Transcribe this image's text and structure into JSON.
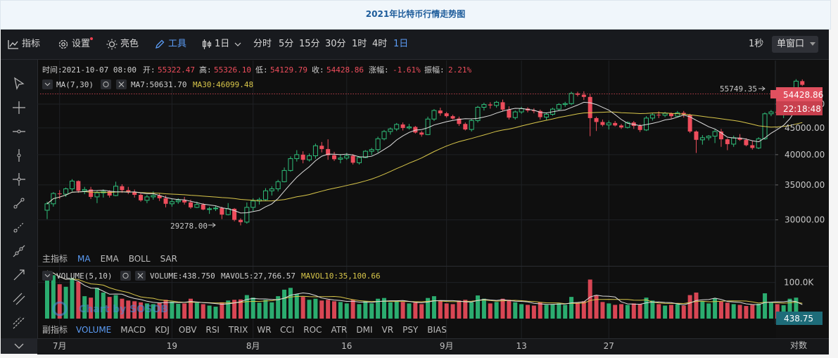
{
  "page": {
    "title": "2021年比特币行情走势图"
  },
  "toolbar": {
    "indicator_label": "指标",
    "settings_label": "设置",
    "theme_label": "亮色",
    "tools_label": "工具",
    "interval_selected": "1日",
    "intervals": [
      "分时",
      "5分",
      "15分",
      "30分",
      "1时",
      "4时",
      "1日"
    ],
    "active_interval": "1日",
    "right_interval": "1秒",
    "layout_label": "单窗口"
  },
  "main_info": {
    "time_label": "时间:",
    "time_value": "2021-10-07 08:00",
    "open_label": "开:",
    "open_value": "55322.47",
    "high_label": "高:",
    "high_value": "55326.10",
    "low_label": "低:",
    "low_value": "54129.79",
    "close_label": "收:",
    "close_value": "54428.86",
    "change_label": "涨幅:",
    "change_value": "-1.61%",
    "amp_label": "振幅:",
    "amp_value": "2.21%"
  },
  "ma_legend": {
    "name": "MA(7,30)",
    "ma7_label": "MA7:50631.70",
    "ma30_label": "MA30:46099.48"
  },
  "main_tabs": {
    "label": "主指标",
    "items": [
      "MA",
      "EMA",
      "BOLL",
      "SAR"
    ],
    "active": "MA"
  },
  "vol_legend": {
    "name": "VOLUME(5,10)",
    "vol_label": "VOLUME:438.750",
    "mavol5_label": "MAVOL5:27,766.57",
    "mavol10_label": "MAVOL10:35,100.66"
  },
  "sub_tabs": {
    "label": "副指标",
    "items": [
      "VOLUME",
      "MACD",
      "KDJ",
      "OBV",
      "RSI",
      "TRIX",
      "WR",
      "CCI",
      "ROC",
      "ATR",
      "DMI",
      "VR",
      "PSY",
      "BIAS"
    ],
    "active": "VOLUME"
  },
  "watermark": "Chart by SOSOB",
  "x_axis": {
    "ticks": [
      "7月",
      "19",
      "8月",
      "16",
      "9月",
      "13",
      "27"
    ],
    "right_label": "对数"
  },
  "price_tags": {
    "last": "54428.86",
    "countdown": "22:18:48",
    "vol_last": "438.75"
  },
  "annotations": {
    "max": "55749.35",
    "min": "29278.00"
  },
  "colors": {
    "up": "#2fbe7a",
    "down": "#ee4d5c",
    "ma7": "#dcdcdc",
    "ma30": "#d8c64a",
    "accent": "#5b9cf5"
  },
  "chart_data": {
    "type": "candlestick",
    "title": "2021年比特币行情走势图",
    "x_start_date": "2021-06-29",
    "x_end_date": "2021-10-07",
    "x_tick_dates": [
      "2021-07-01",
      "2021-07-19",
      "2021-08-01",
      "2021-08-16",
      "2021-09-01",
      "2021-09-13",
      "2021-09-27"
    ],
    "y_ticks": [
      30000,
      35000,
      40000,
      45000,
      50000
    ],
    "y_tick_labels": [
      "30000.00",
      "35000.00",
      "40000.00",
      "45000.00",
      "50000.00"
    ],
    "y_scale": "log",
    "ylim": [
      26300,
      60600
    ],
    "vol_ticks": [
      100000
    ],
    "vol_tick_labels": [
      "100.0K"
    ],
    "vol_max": 140000,
    "ohlc": [
      [
        31300,
        32500,
        30100,
        32200
      ],
      [
        32200,
        33900,
        31800,
        33700
      ],
      [
        33700,
        34200,
        32900,
        33600
      ],
      [
        33600,
        34600,
        33200,
        34400
      ],
      [
        34400,
        35900,
        34000,
        35600
      ],
      [
        35600,
        35700,
        33800,
        34100
      ],
      [
        34100,
        34700,
        33600,
        34300
      ],
      [
        34300,
        34700,
        32900,
        33200
      ],
      [
        33200,
        34100,
        32300,
        33800
      ],
      [
        33800,
        34300,
        33100,
        34000
      ],
      [
        34000,
        34200,
        33100,
        33400
      ],
      [
        33400,
        35500,
        33300,
        34800
      ],
      [
        34800,
        35100,
        33800,
        34200
      ],
      [
        34200,
        34700,
        33600,
        33900
      ],
      [
        33900,
        34300,
        33100,
        33500
      ],
      [
        33500,
        33700,
        32500,
        32700
      ],
      [
        32700,
        33500,
        32300,
        33200
      ],
      [
        33200,
        34000,
        32800,
        33400
      ],
      [
        33400,
        33700,
        32600,
        33000
      ],
      [
        33000,
        33400,
        31700,
        32200
      ],
      [
        32200,
        32900,
        31800,
        32500
      ],
      [
        32500,
        33000,
        32200,
        32700
      ],
      [
        32700,
        33200,
        32100,
        32400
      ],
      [
        32400,
        32800,
        31500,
        31700
      ],
      [
        31700,
        32500,
        31600,
        32100
      ],
      [
        32100,
        32300,
        31300,
        31400
      ],
      [
        31400,
        31800,
        30800,
        31500
      ],
      [
        31500,
        31900,
        31200,
        31600
      ],
      [
        31600,
        31800,
        30100,
        30700
      ],
      [
        30700,
        32300,
        30600,
        31500
      ],
      [
        31500,
        31600,
        29800,
        30000
      ],
      [
        30000,
        30200,
        29278,
        29700
      ],
      [
        29700,
        32400,
        29500,
        31700
      ],
      [
        31700,
        33000,
        31200,
        32600
      ],
      [
        32600,
        33100,
        32100,
        32800
      ],
      [
        32800,
        34500,
        32600,
        34100
      ],
      [
        34100,
        34800,
        33400,
        34400
      ],
      [
        34400,
        35800,
        34000,
        35500
      ],
      [
        35500,
        37800,
        35400,
        37300
      ],
      [
        37300,
        39700,
        37100,
        39300
      ],
      [
        39300,
        40800,
        38800,
        40000
      ],
      [
        40000,
        40600,
        38500,
        39100
      ],
      [
        39100,
        40200,
        38800,
        39800
      ],
      [
        39800,
        42000,
        39300,
        41600
      ],
      [
        41600,
        42300,
        40400,
        41000
      ],
      [
        41000,
        42800,
        39100,
        39900
      ],
      [
        39900,
        40500,
        38900,
        39200
      ],
      [
        39200,
        40100,
        38500,
        39400
      ],
      [
        39400,
        40300,
        39100,
        39800
      ],
      [
        39800,
        40100,
        38300,
        38600
      ],
      [
        38600,
        39700,
        38300,
        39500
      ],
      [
        39500,
        40800,
        39400,
        40600
      ],
      [
        40600,
        41200,
        39900,
        40900
      ],
      [
        40900,
        43300,
        40400,
        42900
      ],
      [
        42900,
        44600,
        42600,
        44300
      ],
      [
        44300,
        45100,
        43700,
        44800
      ],
      [
        44800,
        46000,
        44400,
        45700
      ],
      [
        45700,
        46100,
        44500,
        45000
      ],
      [
        45000,
        45800,
        44700,
        45200
      ],
      [
        45200,
        45400,
        43900,
        44100
      ],
      [
        44100,
        44400,
        43300,
        43700
      ],
      [
        43700,
        47300,
        43600,
        46800
      ],
      [
        46800,
        48900,
        46400,
        48600
      ],
      [
        48600,
        49200,
        47500,
        48000
      ],
      [
        48000,
        48300,
        47100,
        47400
      ],
      [
        47400,
        47700,
        46700,
        46900
      ],
      [
        46900,
        47300,
        45400,
        45800
      ],
      [
        45800,
        46100,
        44500,
        44700
      ],
      [
        44700,
        46900,
        44300,
        46500
      ],
      [
        46500,
        49600,
        46100,
        49300
      ],
      [
        49300,
        50300,
        48600,
        49900
      ],
      [
        49900,
        50400,
        49000,
        49700
      ],
      [
        49700,
        50700,
        49200,
        50400
      ],
      [
        50400,
        51000,
        48500,
        48800
      ],
      [
        48800,
        49500,
        46700,
        47100
      ],
      [
        47100,
        48600,
        46700,
        48300
      ],
      [
        48300,
        49400,
        47900,
        49000
      ],
      [
        49000,
        49300,
        48200,
        48600
      ],
      [
        48600,
        49100,
        48000,
        48500
      ],
      [
        48500,
        48800,
        46700,
        47200
      ],
      [
        47200,
        48200,
        46600,
        47800
      ],
      [
        47800,
        49200,
        47500,
        48900
      ],
      [
        48900,
        50200,
        48600,
        49900
      ],
      [
        49900,
        50500,
        49400,
        50100
      ],
      [
        50100,
        52800,
        49800,
        52400
      ],
      [
        52400,
        52800,
        51700,
        52100
      ],
      [
        52100,
        52900,
        50900,
        51600
      ],
      [
        51600,
        52300,
        43400,
        47000
      ],
      [
        47000,
        47300,
        44400,
        46200
      ],
      [
        46200,
        46700,
        45300,
        45600
      ],
      [
        45600,
        46500,
        44700,
        46000
      ],
      [
        46000,
        46400,
        45300,
        45500
      ],
      [
        45500,
        45800,
        44800,
        45100
      ],
      [
        45100,
        46300,
        44900,
        46100
      ],
      [
        46100,
        46400,
        44800,
        45400
      ],
      [
        45400,
        45800,
        44200,
        44600
      ],
      [
        44600,
        47400,
        44400,
        47000
      ],
      [
        47000,
        48000,
        46500,
        47700
      ],
      [
        47700,
        48400,
        47000,
        47600
      ],
      [
        47600,
        48300,
        47200,
        48000
      ],
      [
        48000,
        48200,
        46900,
        47400
      ],
      [
        47400,
        48500,
        47300,
        48100
      ],
      [
        48100,
        48500,
        47100,
        47700
      ],
      [
        47700,
        47900,
        44000,
        44300
      ],
      [
        44300,
        44500,
        40300,
        42700
      ],
      [
        42700,
        43600,
        41800,
        43100
      ],
      [
        43100,
        43600,
        42600,
        43400
      ],
      [
        43400,
        44700,
        42100,
        44300
      ],
      [
        44300,
        44800,
        41400,
        42800
      ],
      [
        42800,
        43000,
        40800,
        41900
      ],
      [
        41900,
        43500,
        41400,
        43100
      ],
      [
        43100,
        43800,
        42500,
        42700
      ],
      [
        42700,
        43000,
        41500,
        41700
      ],
      [
        41700,
        42500,
        40900,
        41200
      ],
      [
        41200,
        43200,
        41000,
        42900
      ],
      [
        42900,
        48200,
        42700,
        47900
      ],
      [
        47900,
        48700,
        47400,
        48300
      ],
      [
        48300,
        49400,
        47900,
        48200
      ],
      [
        48200,
        48800,
        47000,
        48500
      ],
      [
        48500,
        51600,
        48200,
        51000
      ],
      [
        51000,
        55800,
        50700,
        55322
      ],
      [
        55322,
        55749,
        54130,
        54429
      ]
    ],
    "volume": [
      132000,
      120000,
      95000,
      88000,
      112000,
      102000,
      62000,
      58000,
      85000,
      72000,
      60000,
      65000,
      55000,
      50000,
      48000,
      45000,
      42000,
      40000,
      43000,
      52000,
      47000,
      41000,
      42000,
      55000,
      44000,
      40000,
      36000,
      33000,
      45000,
      50000,
      52000,
      53000,
      65000,
      58000,
      44000,
      52000,
      45000,
      62000,
      80000,
      85000,
      68000,
      60000,
      52000,
      55000,
      50000,
      52000,
      48000,
      46000,
      42000,
      52000,
      40000,
      48000,
      42000,
      55000,
      57000,
      45000,
      48000,
      46000,
      42000,
      44000,
      40000,
      57000,
      62000,
      48000,
      42000,
      40000,
      50000,
      52000,
      45000,
      64000,
      55000,
      42000,
      46000,
      55000,
      52000,
      45000,
      40000,
      38000,
      36000,
      45000,
      38000,
      40000,
      42000,
      38000,
      60000,
      44000,
      48000,
      108000,
      65000,
      46000,
      42000,
      38000,
      40000,
      38000,
      42000,
      40000,
      58000,
      50000,
      40000,
      36000,
      38000,
      40000,
      36000,
      65000,
      72000,
      48000,
      42000,
      56000,
      47000,
      44000,
      40000,
      38000,
      35000,
      38000,
      41000,
      70000,
      44000,
      40000,
      37000,
      55000,
      58000,
      3000
    ],
    "series": [
      {
        "name": "MA7"
      },
      {
        "name": "MA30"
      }
    ]
  }
}
